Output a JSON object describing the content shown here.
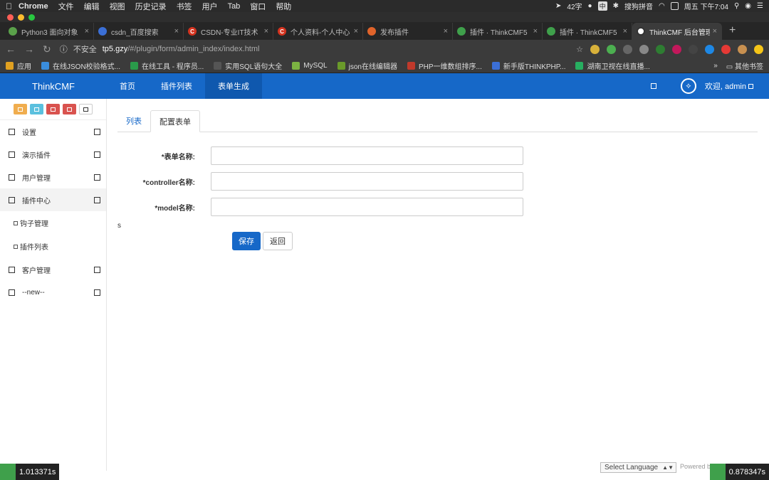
{
  "menubar": {
    "app": "Chrome",
    "items": [
      "文件",
      "编辑",
      "视图",
      "历史记录",
      "书签",
      "用户",
      "Tab",
      "窗口",
      "帮助"
    ],
    "status_text": "42字",
    "ime_label": "中",
    "ime_name": "搜狗拼音",
    "clock": "周五 下午7:04"
  },
  "tabs": [
    {
      "title": "Python3 面向对象",
      "color": "#5aa14a",
      "glyph": ""
    },
    {
      "title": "csdn_百度搜索",
      "color": "#3b6fd6",
      "glyph": ""
    },
    {
      "title": "CSDN-专业IT技术",
      "color": "#d4331f",
      "glyph": "C"
    },
    {
      "title": "个人资料-个人中心",
      "color": "#d4331f",
      "glyph": "C"
    },
    {
      "title": "发布插件",
      "color": "#e0632a",
      "glyph": ""
    },
    {
      "title": "插件 · ThinkCMF5",
      "color": "#3fa04b",
      "glyph": ""
    },
    {
      "title": "插件 · ThinkCMF5",
      "color": "#3fa04b",
      "glyph": ""
    },
    {
      "title": "ThinkCMF 后台管理",
      "color": "#ffffff",
      "glyph": ""
    }
  ],
  "address": {
    "insecure_label": "不安全",
    "host": "tp5.gzy",
    "path": "/#/plugin/form/admin_index/index.html"
  },
  "bookmarks": {
    "items": [
      {
        "label": "应用",
        "color": "#e0a020"
      },
      {
        "label": "在线JSON校验格式...",
        "color": "#3a8ddc"
      },
      {
        "label": "在线工具 - 程序员...",
        "color": "#2a9a4a"
      },
      {
        "label": "实用SQL语句大全",
        "color": "#555555"
      },
      {
        "label": "MySQL",
        "color": "#7cb342"
      },
      {
        "label": "json在线编辑器",
        "color": "#6a9a2a"
      },
      {
        "label": "PHP一维数组排序...",
        "color": "#c0392b"
      },
      {
        "label": "新手版THINKPHP...",
        "color": "#3b6fd6"
      },
      {
        "label": "湖南卫视在线直播...",
        "color": "#27ae60"
      }
    ],
    "more": "»",
    "other": "其他书签"
  },
  "app": {
    "brand": "ThinkCMF",
    "nav": [
      "首页",
      "插件列表",
      "表单生成"
    ],
    "active_nav": 2,
    "welcome": "欢迎, admin"
  },
  "sidebar": {
    "color_buttons": [
      "#f0ad4e",
      "#5bc0de",
      "#d9534f",
      "#d9534f",
      "#ffffff"
    ],
    "items": [
      {
        "label": "设置"
      },
      {
        "label": "演示插件"
      },
      {
        "label": "用户管理"
      },
      {
        "label": "插件中心",
        "open": true,
        "children": [
          "钩子管理",
          "插件列表"
        ]
      },
      {
        "label": "客户管理"
      },
      {
        "label": "--new--"
      }
    ]
  },
  "content": {
    "tabs": [
      "列表",
      "配置表单"
    ],
    "active_tab": 1,
    "fields": [
      {
        "label": "*表单名称:",
        "value": ""
      },
      {
        "label": "*controller名称:",
        "value": ""
      },
      {
        "label": "*model名称:",
        "value": ""
      }
    ],
    "stray_text": "s",
    "save_label": "保存",
    "back_label": "返回"
  },
  "footer": {
    "left_timer": "1.013371s",
    "right_timer": "0.878347s",
    "language_select": "Select Language",
    "powered": "Powered b"
  }
}
